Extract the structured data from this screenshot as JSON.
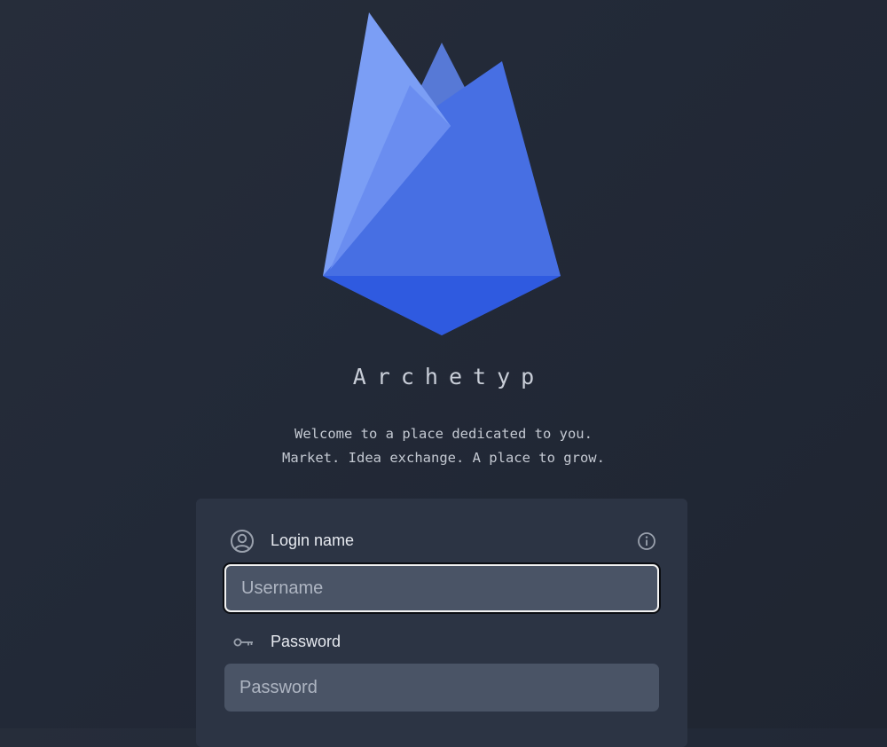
{
  "app": {
    "name": "Archetyp",
    "tagline_line1": "Welcome to a place dedicated to you.",
    "tagline_line2": "Market. Idea exchange. A place to grow."
  },
  "colors": {
    "background": "#232a37",
    "card": "#2c3444",
    "input": "#4a5466",
    "logo_light": "#7a9cf4",
    "logo_mid": "#4b73e6",
    "logo_dark": "#2f5be0"
  },
  "icons": {
    "login": "user-circle-icon",
    "info": "info-icon",
    "password": "key-icon"
  },
  "login_form": {
    "login_label": "Login name",
    "username_placeholder": "Username",
    "username_value": "",
    "password_label": "Password",
    "password_placeholder": "Password",
    "password_value": ""
  }
}
